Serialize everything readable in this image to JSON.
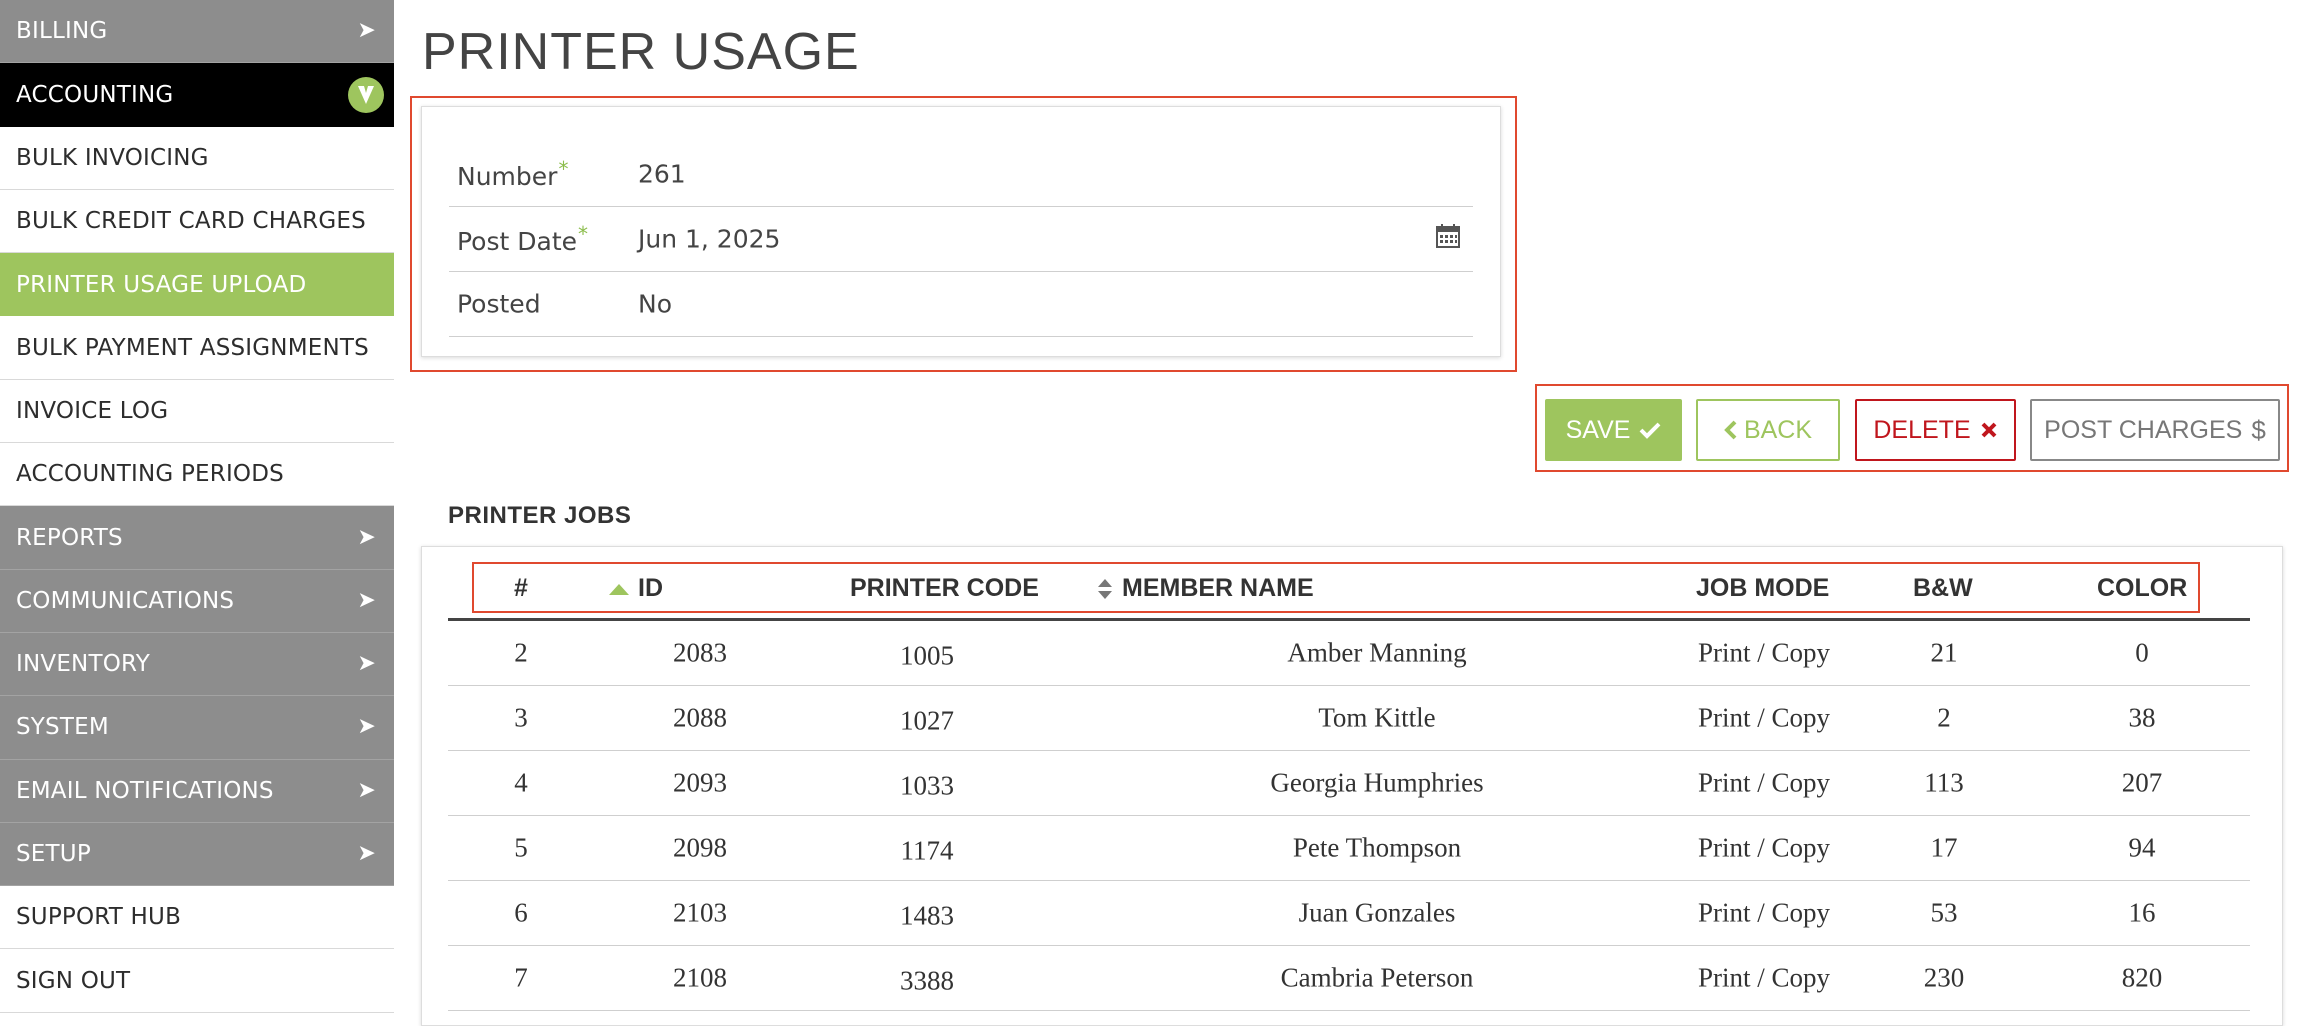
{
  "sidebar": {
    "items": [
      {
        "label": "BILLING",
        "style": "grey",
        "expandable": true
      },
      {
        "label": "ACCOUNTING",
        "style": "black",
        "expanded": true
      },
      {
        "label": "BULK INVOICING",
        "style": "white"
      },
      {
        "label": "BULK CREDIT CARD CHARGES",
        "style": "white"
      },
      {
        "label": "PRINTER USAGE UPLOAD",
        "style": "green",
        "active": true
      },
      {
        "label": "BULK PAYMENT ASSIGNMENTS",
        "style": "white"
      },
      {
        "label": "INVOICE LOG",
        "style": "white"
      },
      {
        "label": "ACCOUNTING PERIODS",
        "style": "white"
      },
      {
        "label": "REPORTS",
        "style": "grey",
        "expandable": true
      },
      {
        "label": "COMMUNICATIONS",
        "style": "grey",
        "expandable": true
      },
      {
        "label": "INVENTORY",
        "style": "grey",
        "expandable": true
      },
      {
        "label": "SYSTEM",
        "style": "grey",
        "expandable": true
      },
      {
        "label": "EMAIL NOTIFICATIONS",
        "style": "grey",
        "expandable": true
      },
      {
        "label": "SETUP",
        "style": "grey",
        "expandable": true
      },
      {
        "label": "SUPPORT HUB",
        "style": "white"
      },
      {
        "label": "SIGN OUT",
        "style": "white"
      }
    ]
  },
  "page": {
    "title": "PRINTER USAGE"
  },
  "form": {
    "number_label": "Number",
    "number_value": "261",
    "post_date_label": "Post Date",
    "post_date_value": "Jun 1, 2025",
    "posted_label": "Posted",
    "posted_value": "No",
    "required_mark": "*"
  },
  "actions": {
    "save": "SAVE",
    "back": "BACK",
    "delete": "DELETE",
    "post_charges": "POST CHARGES"
  },
  "printer_jobs": {
    "title": "PRINTER JOBS",
    "columns": {
      "num": "#",
      "id": "ID",
      "printer_code": "PRINTER CODE",
      "member_name": "MEMBER NAME",
      "job_mode": "JOB MODE",
      "bw": "B&W",
      "color": "COLOR"
    },
    "rows": [
      {
        "num": "2",
        "id": "2083",
        "printer_code": "1005",
        "member_name": "Amber Manning",
        "job_mode": "Print / Copy",
        "bw": "21",
        "color": "0"
      },
      {
        "num": "3",
        "id": "2088",
        "printer_code": "1027",
        "member_name": "Tom Kittle",
        "job_mode": "Print / Copy",
        "bw": "2",
        "color": "38"
      },
      {
        "num": "4",
        "id": "2093",
        "printer_code": "1033",
        "member_name": "Georgia Humphries",
        "job_mode": "Print / Copy",
        "bw": "113",
        "color": "207"
      },
      {
        "num": "5",
        "id": "2098",
        "printer_code": "1174",
        "member_name": "Pete Thompson",
        "job_mode": "Print / Copy",
        "bw": "17",
        "color": "94"
      },
      {
        "num": "6",
        "id": "2103",
        "printer_code": "1483",
        "member_name": "Juan Gonzales",
        "job_mode": "Print / Copy",
        "bw": "53",
        "color": "16"
      },
      {
        "num": "7",
        "id": "2108",
        "printer_code": "3388",
        "member_name": "Cambria Peterson",
        "job_mode": "Print / Copy",
        "bw": "230",
        "color": "820"
      }
    ]
  },
  "colors": {
    "accent_green": "#9ec55e",
    "danger_red": "#c0161d",
    "highlight_red": "#e0492f",
    "nav_grey": "#8d8d8d"
  }
}
